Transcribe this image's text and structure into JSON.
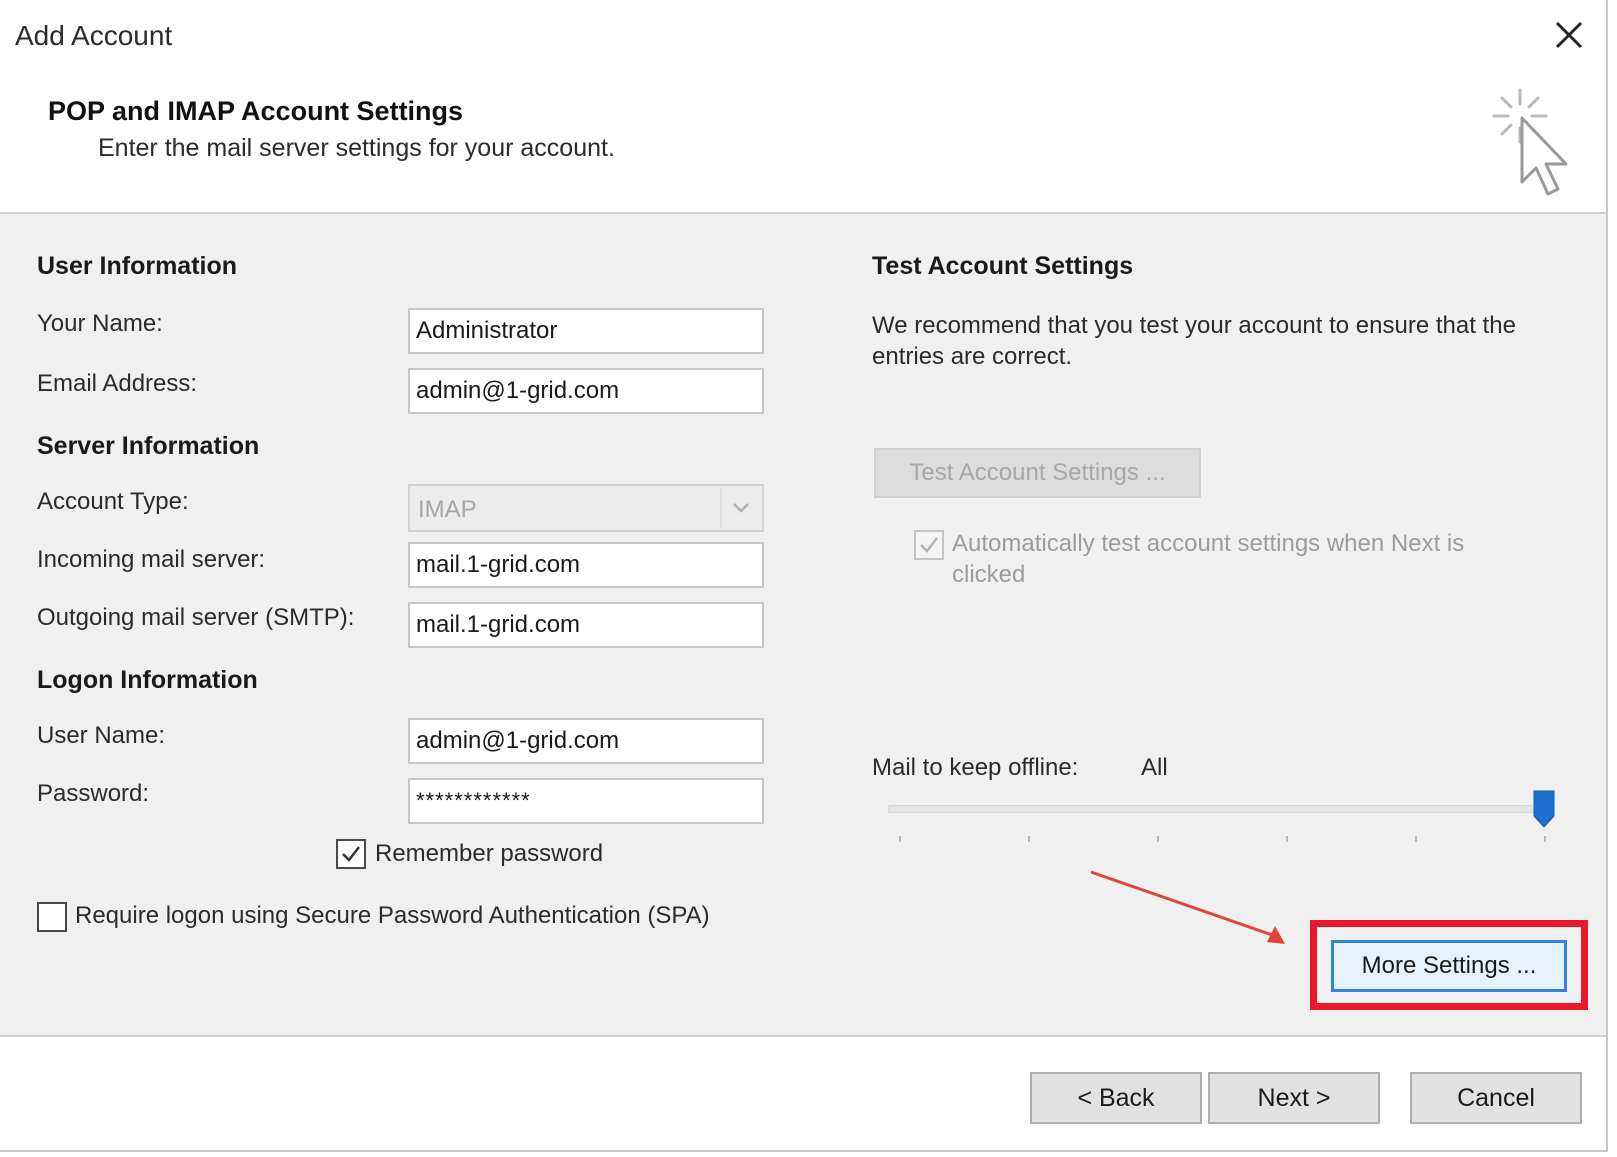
{
  "window": {
    "title": "Add Account",
    "close_icon": "close-icon"
  },
  "header": {
    "title": "POP and IMAP Account Settings",
    "subtitle": "Enter the mail server settings for your account.",
    "icon": "wizard-cursor-icon"
  },
  "user_info": {
    "section_title": "User Information",
    "name_label": "Your Name:",
    "name_value": "Administrator",
    "email_label": "Email Address:",
    "email_value": "admin@1-grid.com"
  },
  "server_info": {
    "section_title": "Server Information",
    "account_type_label": "Account Type:",
    "account_type_value": "IMAP",
    "incoming_label": "Incoming mail server:",
    "incoming_value": "mail.1-grid.com",
    "outgoing_label": "Outgoing mail server (SMTP):",
    "outgoing_value": "mail.1-grid.com"
  },
  "logon_info": {
    "section_title": "Logon Information",
    "username_label": "User Name:",
    "username_value": "admin@1-grid.com",
    "password_label": "Password:",
    "password_value": "************",
    "remember_label": "Remember password",
    "remember_checked": true,
    "spa_label": "Require logon using Secure Password Authentication (SPA)",
    "spa_checked": false
  },
  "test_settings": {
    "section_title": "Test Account Settings",
    "description": "We recommend that you test your account to ensure that the entries are correct.",
    "test_button": "Test Account Settings ...",
    "auto_test_label": "Automatically test account settings when Next is clicked",
    "auto_test_checked": true
  },
  "offline": {
    "label": "Mail to keep offline:",
    "value": "All",
    "slider_level": 1.0
  },
  "more_settings_button": "More Settings ...",
  "footer": {
    "back": "< Back",
    "next": "Next >",
    "cancel": "Cancel"
  },
  "colors": {
    "highlight": "#e8192c",
    "focus_border": "#2f86d8",
    "slider_thumb": "#1e6fcf",
    "body_bg": "#f0f0f0"
  }
}
